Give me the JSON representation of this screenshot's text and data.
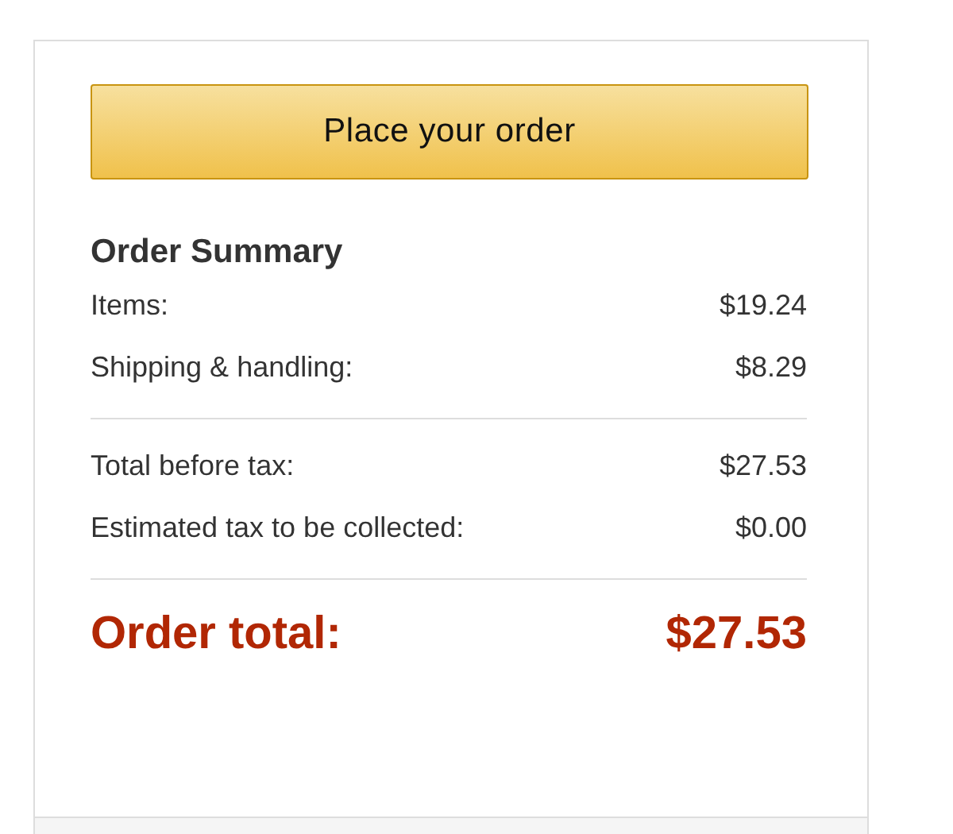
{
  "place_order_button": {
    "label": "Place your order"
  },
  "order_summary": {
    "title": "Order Summary",
    "sections": [
      {
        "rows": [
          {
            "label": "Items:",
            "amount": "$19.24"
          },
          {
            "label": "Shipping & handling:",
            "amount": "$8.29"
          }
        ]
      },
      {
        "rows": [
          {
            "label": "Total before tax:",
            "amount": "$27.53"
          },
          {
            "label": "Estimated tax to be collected:",
            "amount": "$0.00"
          }
        ]
      }
    ],
    "total": {
      "label": "Order total:",
      "amount": "$27.53"
    }
  }
}
